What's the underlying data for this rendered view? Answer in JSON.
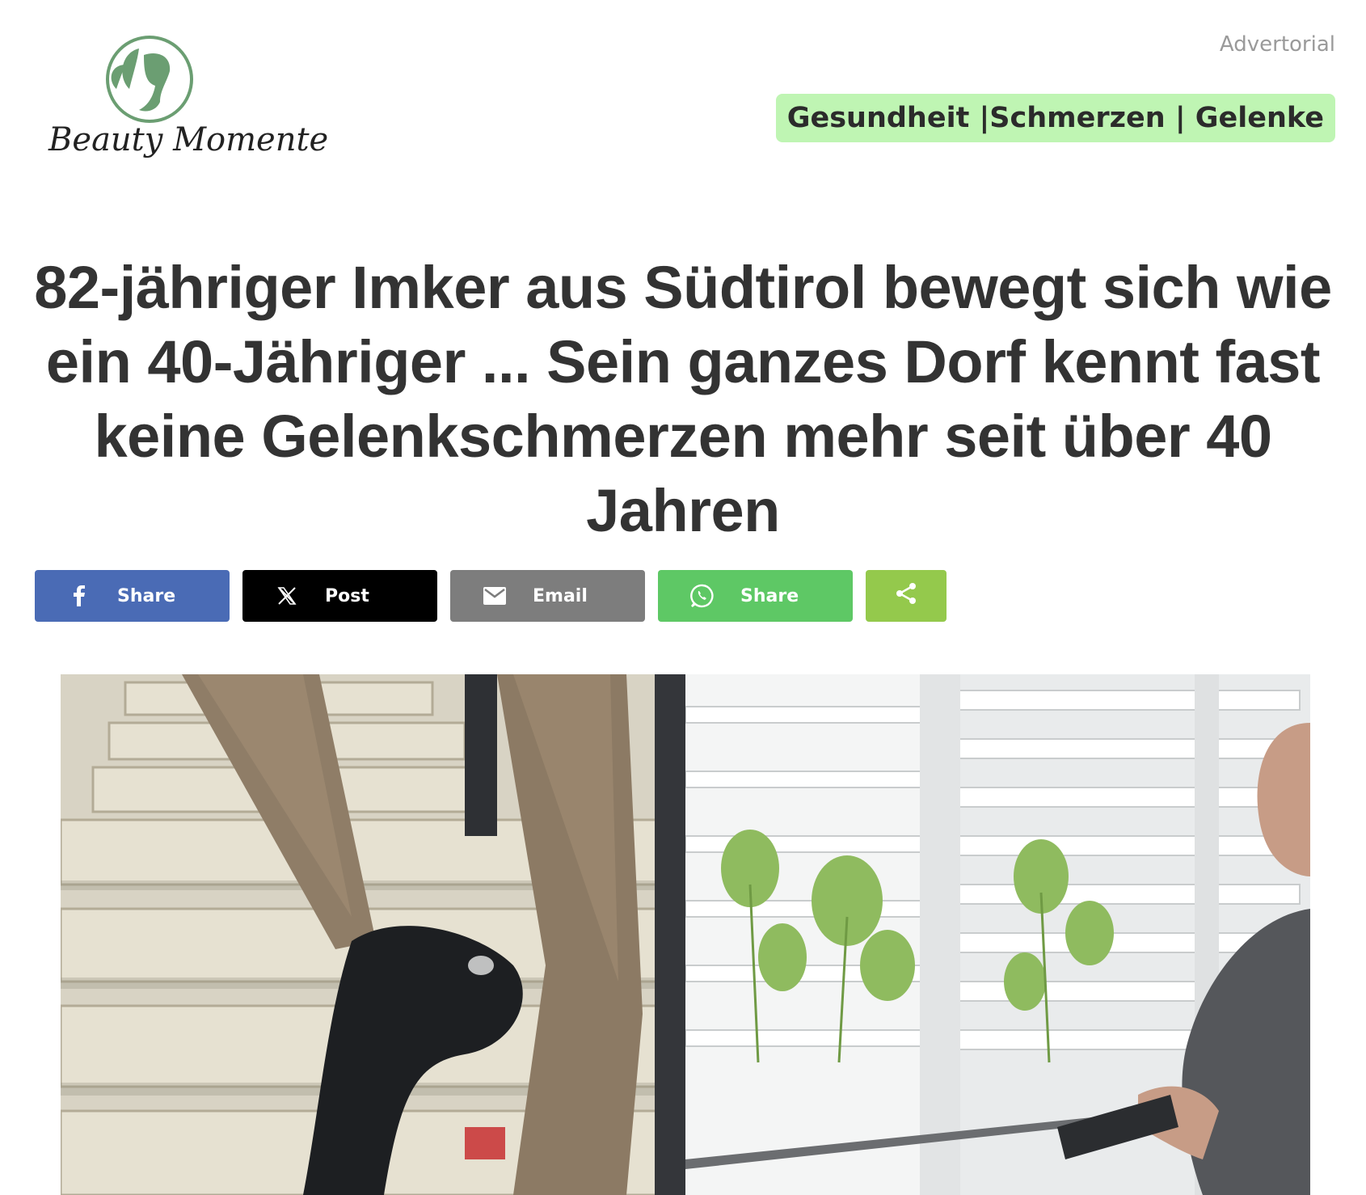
{
  "brand": {
    "logo_text": "Beauty Momente",
    "logo_color": "#6b9e72"
  },
  "advertorial_label": "Advertorial",
  "category": {
    "text": "Gesundheit |Schmerzen | Gelenke",
    "background": "#bff5b3"
  },
  "headline": "82-jähriger Imker aus Südtirol bewegt sich wie ein 40-Jähriger ... Sein ganzes Dorf kennt fast keine Gelenkschmerzen mehr seit über 40 Jahren",
  "share_buttons": [
    {
      "network": "facebook",
      "icon": "facebook-icon",
      "label": "Share",
      "color": "#4a6bb5"
    },
    {
      "network": "x",
      "icon": "x-icon",
      "label": "Post",
      "color": "#000000"
    },
    {
      "network": "email",
      "icon": "email-icon",
      "label": "Email",
      "color": "#7d7d7d"
    },
    {
      "network": "whatsapp",
      "icon": "whatsapp-icon",
      "label": "Share",
      "color": "#5ec865"
    },
    {
      "network": "sharethis",
      "icon": "share-icon",
      "label": "",
      "color": "#94c94c"
    }
  ],
  "hero_images": [
    {
      "name": "stairs-walking-image"
    },
    {
      "name": "man-stretching-window-image"
    }
  ]
}
